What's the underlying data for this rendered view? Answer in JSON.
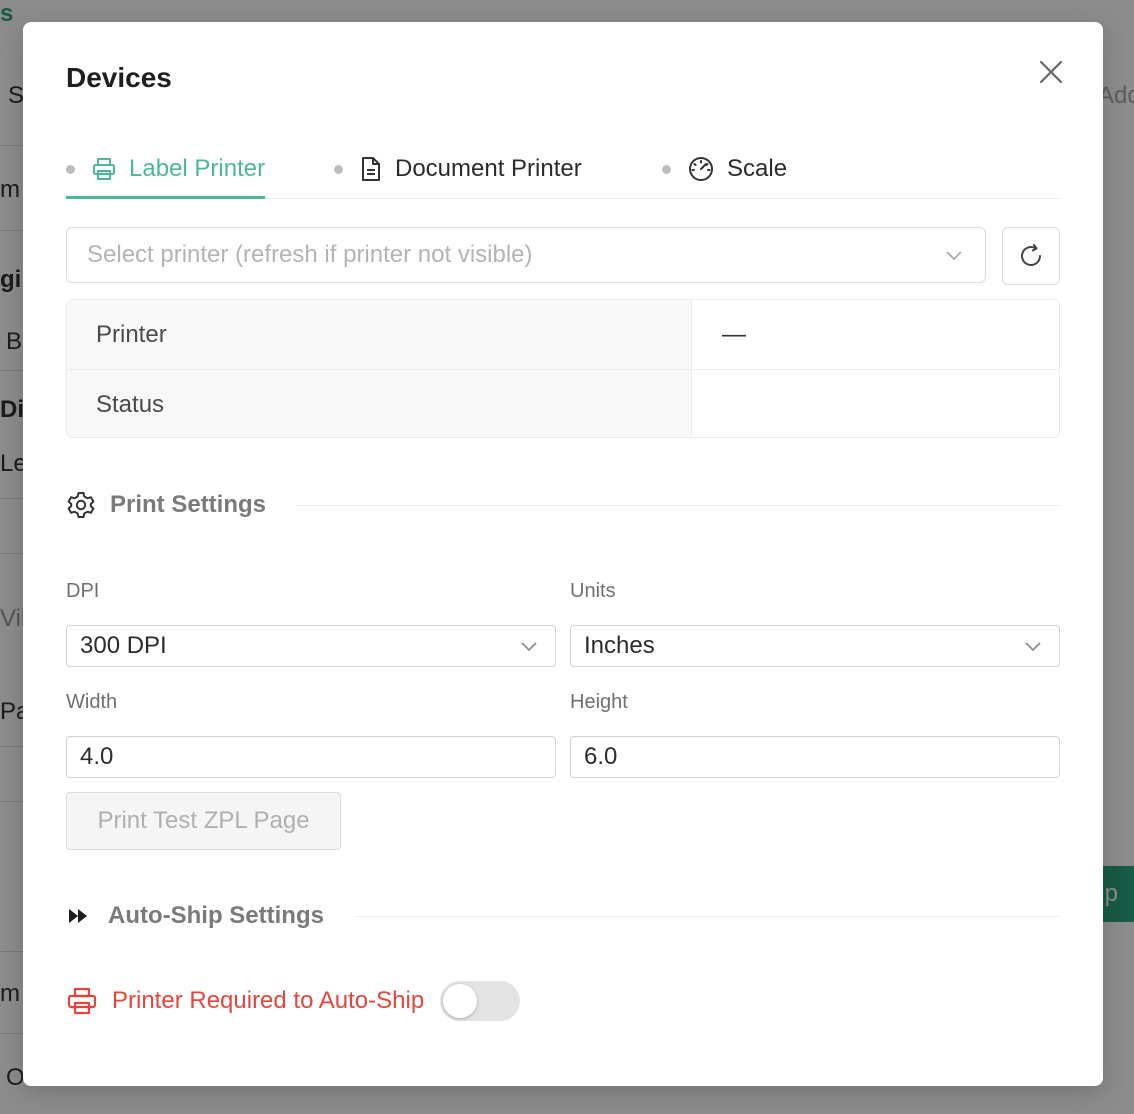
{
  "background": {
    "fragments": [
      "s",
      "S",
      "m",
      "gi",
      "B",
      "Di",
      "Le",
      "Vill",
      "Pa",
      "m",
      "O",
      "Add",
      "hip"
    ]
  },
  "modal": {
    "title": "Devices",
    "tabs": [
      {
        "label": "Label Printer",
        "icon": "printer-icon",
        "active": true
      },
      {
        "label": "Document Printer",
        "icon": "document-icon",
        "active": false
      },
      {
        "label": "Scale",
        "icon": "gauge-icon",
        "active": false
      }
    ],
    "printer_select": {
      "placeholder": "Select printer (refresh if printer not visible)"
    },
    "info": {
      "rows": [
        {
          "label": "Printer",
          "value": "—"
        },
        {
          "label": "Status",
          "value": ""
        }
      ]
    },
    "print_settings": {
      "title": "Print Settings",
      "dpi": {
        "label": "DPI",
        "value": "300 DPI"
      },
      "units": {
        "label": "Units",
        "value": "Inches"
      },
      "width": {
        "label": "Width",
        "value": "4.0"
      },
      "height": {
        "label": "Height",
        "value": "6.0"
      },
      "test_button": "Print Test ZPL Page"
    },
    "auto_ship": {
      "title": "Auto-Ship Settings",
      "printer_required_label": "Printer Required to Auto-Ship",
      "printer_required_enabled": false
    }
  },
  "colors": {
    "accent": "#4cb89a",
    "danger": "#e5453b",
    "background_button": "#2aa57f"
  }
}
